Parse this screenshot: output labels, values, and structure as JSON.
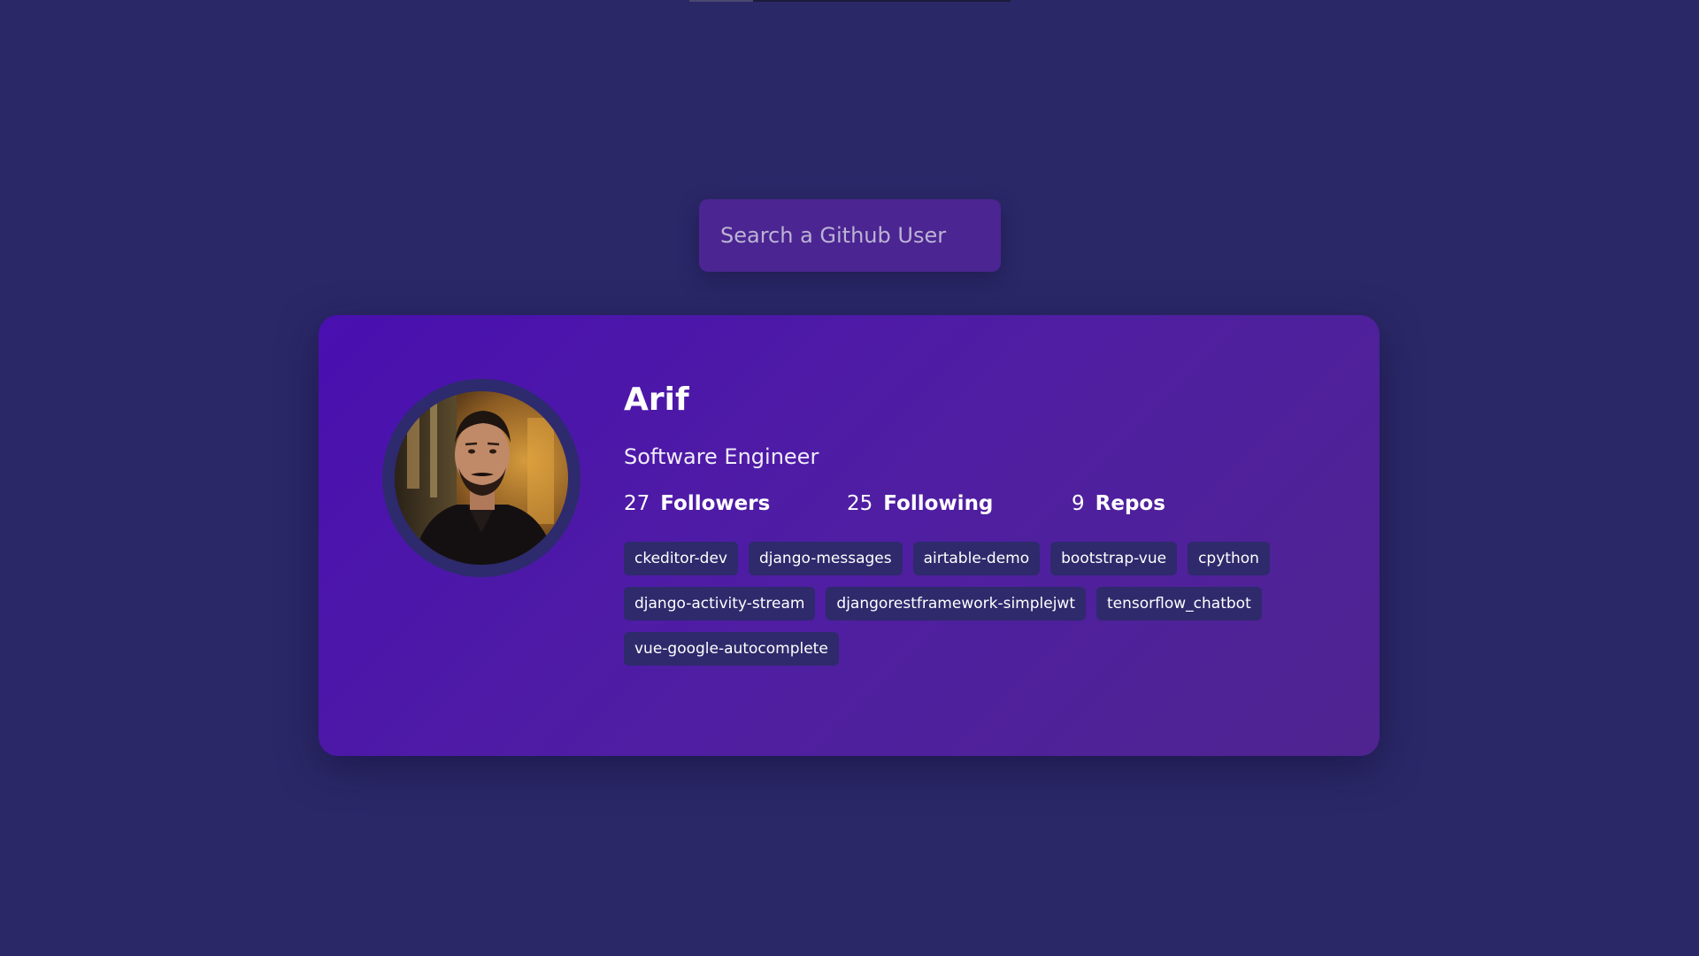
{
  "search": {
    "placeholder": "Search a Github User",
    "value": ""
  },
  "profile": {
    "name": "Arif",
    "bio": "Software Engineer",
    "avatar_alt": "avatar",
    "stats": {
      "followers_count": "27",
      "followers_label": "Followers",
      "following_count": "25",
      "following_label": "Following",
      "repos_count": "9",
      "repos_label": "Repos"
    },
    "repos": [
      "ckeditor-dev",
      "django-messages",
      "airtable-demo",
      "bootstrap-vue",
      "cpython",
      "django-activity-stream",
      "djangorestframework-simplejwt",
      "tensorflow_chatbot",
      "vue-google-autocomplete"
    ]
  },
  "colors": {
    "page_background": "#2b2868",
    "card_gradient_start": "#4a0fb0",
    "card_gradient_end": "#4f2490",
    "search_background": "#4b2592",
    "tag_background": "#2e2a6c",
    "avatar_ring": "#2d2a6e"
  }
}
